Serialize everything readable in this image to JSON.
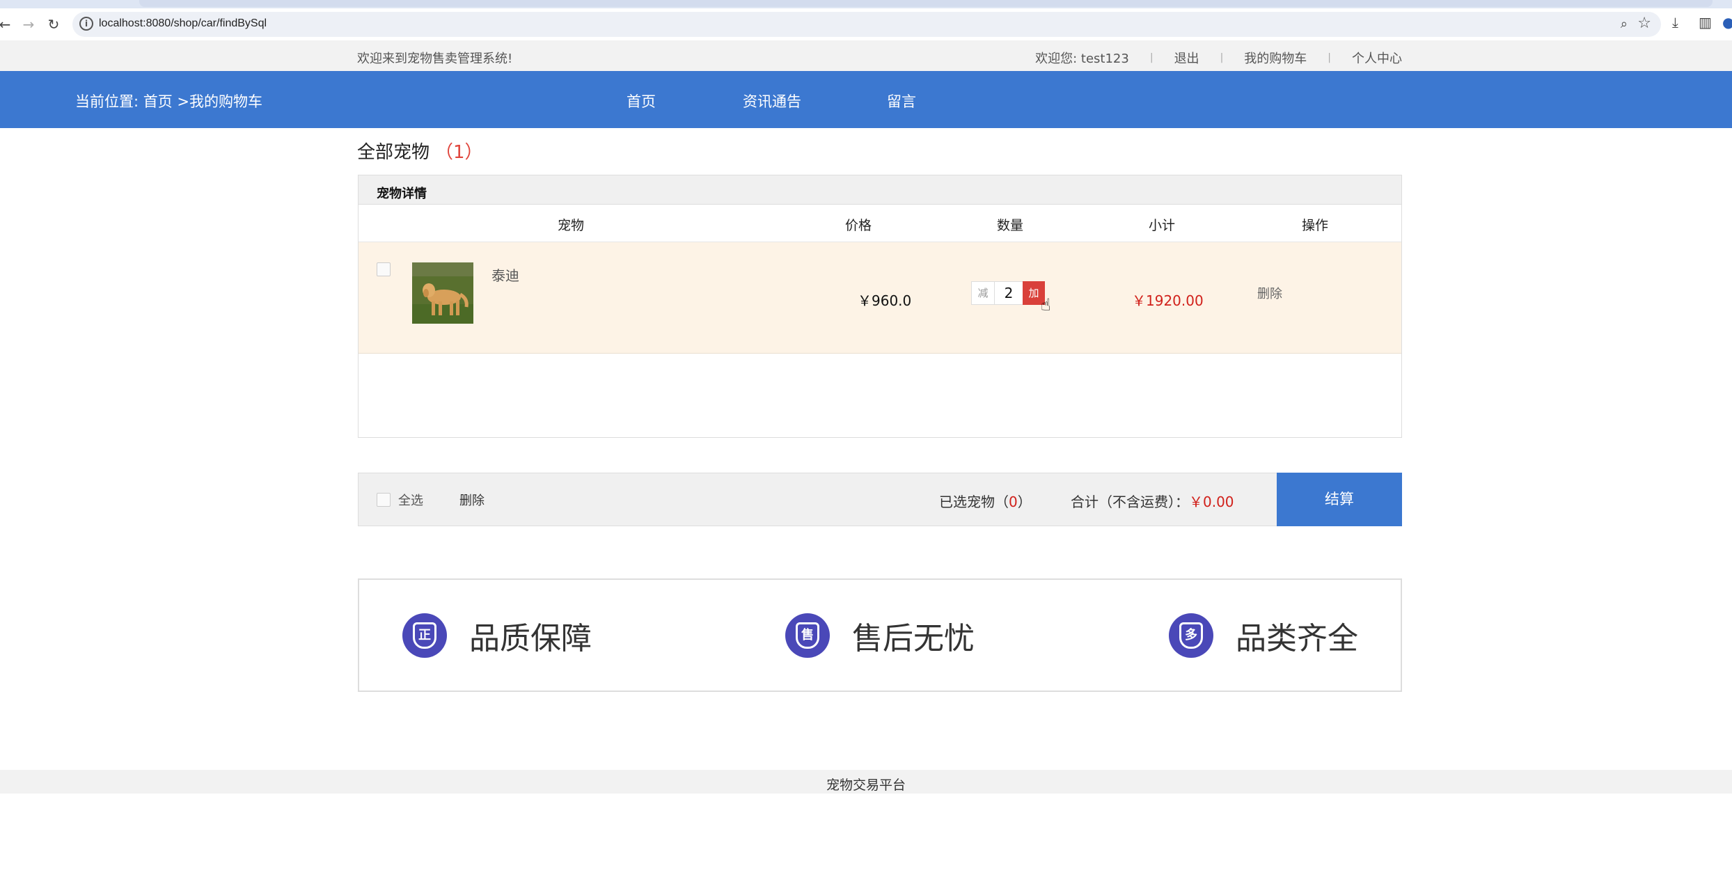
{
  "browser": {
    "url": "localhost:8080/shop/car/findBySql"
  },
  "topbar": {
    "welcome": "欢迎来到宠物售卖管理系统!",
    "greeting": "欢迎您:  test123",
    "logout": "退出",
    "my_cart": "我的购物车",
    "personal_center": "个人中心"
  },
  "header": {
    "breadcrumb": "当前位置:  首页 >我的购物车",
    "nav": [
      "首页",
      "资讯通告",
      "留言"
    ]
  },
  "cart": {
    "title": "全部宠物",
    "count": "（1）",
    "section_header": "宠物详情",
    "columns": [
      "宠物",
      "价格",
      "数量",
      "小计",
      "操作"
    ],
    "items": [
      {
        "name": "泰迪",
        "price": "￥960.0",
        "decrease_label": "减",
        "quantity": "2",
        "increase_label": "加",
        "subtotal": "￥1920.00",
        "delete_label": "删除"
      }
    ]
  },
  "summary": {
    "select_all": "全选",
    "delete": "删除",
    "selected_prefix": "已选宠物（",
    "selected_count": "0",
    "selected_suffix": "）",
    "total_label": "合计（不含运费）：",
    "total_value": "￥0.00",
    "checkout": "结算"
  },
  "features": [
    {
      "badge": "正",
      "text": "品质保障"
    },
    {
      "badge": "售",
      "text": "售后无忧"
    },
    {
      "badge": "多",
      "text": "品类齐全"
    }
  ],
  "footer": {
    "text": "宠物交易平台"
  },
  "colors": {
    "primary_blue": "#3c78d0",
    "accent_red": "#d1211b",
    "row_highlight": "#fdf3e6",
    "badge_purple": "#4a48b8"
  }
}
